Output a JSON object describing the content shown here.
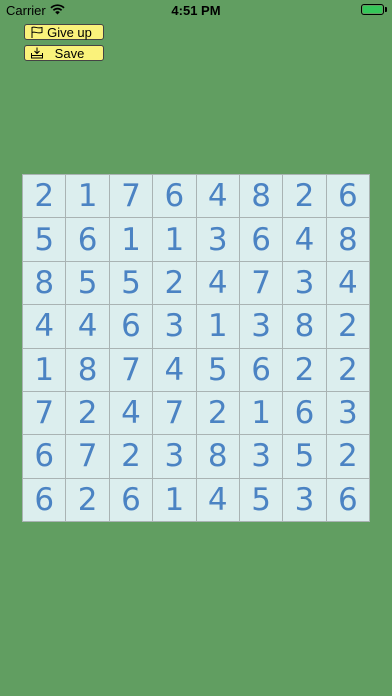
{
  "status_bar": {
    "carrier": "Carrier",
    "time": "4:51 PM",
    "wifi_icon": "wifi-icon",
    "battery_icon": "battery-icon"
  },
  "toolbar": {
    "give_up_label": "Give up",
    "give_up_icon": "flag-icon",
    "save_label": "Save",
    "save_icon": "save-tray-icon"
  },
  "colors": {
    "background": "#619e61",
    "button_fill": "#faf27b",
    "cell_fill": "#dceeee",
    "digit_color": "#4b83c3",
    "grid_line": "#a9b3b3"
  },
  "board": {
    "rows": [
      [
        "2",
        "1",
        "7",
        "6",
        "4",
        "8",
        "2",
        "6"
      ],
      [
        "5",
        "6",
        "1",
        "1",
        "3",
        "6",
        "4",
        "8"
      ],
      [
        "8",
        "5",
        "5",
        "2",
        "4",
        "7",
        "3",
        "4"
      ],
      [
        "4",
        "4",
        "6",
        "3",
        "1",
        "3",
        "8",
        "2"
      ],
      [
        "1",
        "8",
        "7",
        "4",
        "5",
        "6",
        "2",
        "2"
      ],
      [
        "7",
        "2",
        "4",
        "7",
        "2",
        "1",
        "6",
        "3"
      ],
      [
        "6",
        "7",
        "2",
        "3",
        "8",
        "3",
        "5",
        "2"
      ],
      [
        "6",
        "2",
        "6",
        "1",
        "4",
        "5",
        "3",
        "6"
      ]
    ]
  }
}
